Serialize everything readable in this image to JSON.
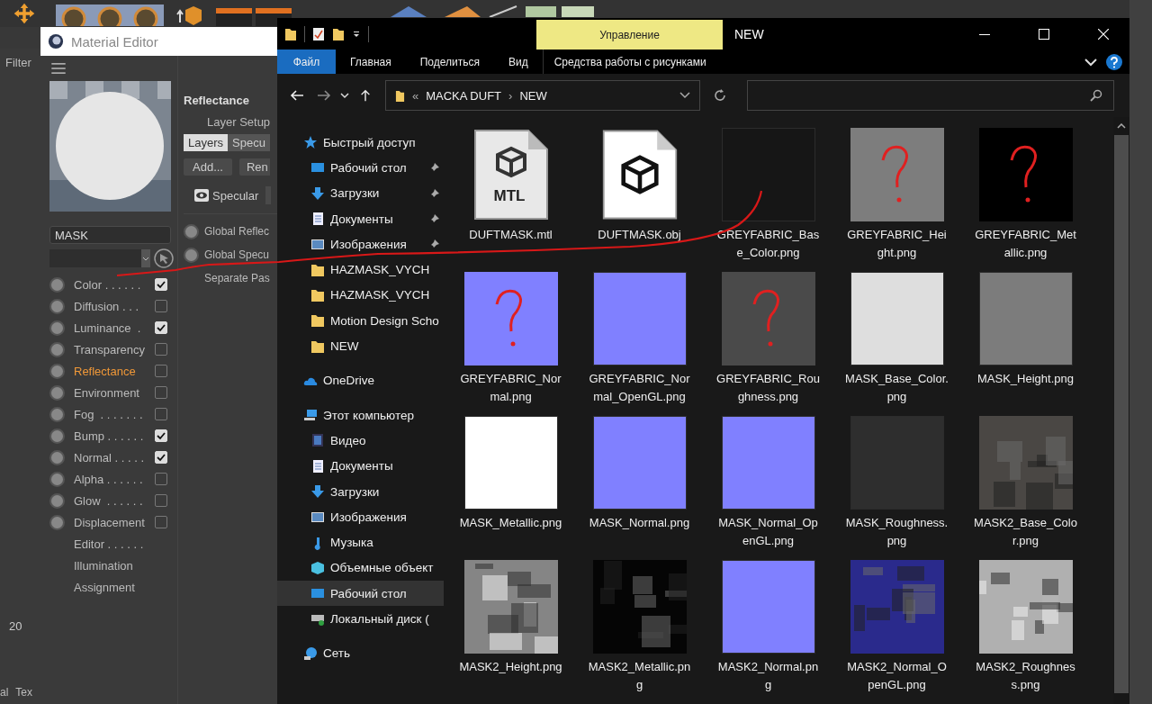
{
  "app_background": {
    "filter_label": "Filter",
    "frame_number": "20",
    "bottom_tabs": [
      "al",
      "Tex"
    ]
  },
  "material_editor": {
    "title": "Material Editor",
    "material_name": "MASK",
    "channels": [
      {
        "kind": "channel",
        "label": "Color . . . . . .",
        "checked": true,
        "selected": false
      },
      {
        "kind": "channel",
        "label": "Diffusion . . .",
        "checked": false,
        "selected": false
      },
      {
        "kind": "channel",
        "label": "Luminance  .",
        "checked": true,
        "selected": false
      },
      {
        "kind": "channel",
        "label": "Transparency",
        "checked": false,
        "selected": false
      },
      {
        "kind": "channel",
        "label": "Reflectance",
        "checked": false,
        "selected": true
      },
      {
        "kind": "channel",
        "label": "Environment",
        "checked": false,
        "selected": false
      },
      {
        "kind": "channel",
        "label": "Fog  . . . . . . .",
        "checked": false,
        "selected": false
      },
      {
        "kind": "channel",
        "label": "Bump . . . . . .",
        "checked": true,
        "selected": false
      },
      {
        "kind": "channel",
        "label": "Normal . . . . .",
        "checked": true,
        "selected": false
      },
      {
        "kind": "channel",
        "label": "Alpha . . . . . .",
        "checked": false,
        "selected": false
      },
      {
        "kind": "channel",
        "label": "Glow  . . . . . .",
        "checked": false,
        "selected": false
      },
      {
        "kind": "channel",
        "label": "Displacement",
        "checked": false,
        "selected": false
      },
      {
        "kind": "page",
        "label": "Editor . . . . . .",
        "selected": false
      },
      {
        "kind": "page",
        "label": "Illumination",
        "selected": false
      },
      {
        "kind": "page",
        "label": "Assignment",
        "selected": false
      }
    ],
    "section_title": "Reflectance",
    "layer_setup_label": "Layer Setup",
    "tabs": [
      {
        "label": "Layers",
        "selected": true
      },
      {
        "label": "Specu",
        "selected": false
      }
    ],
    "buttons": [
      "Add...",
      "Ren"
    ],
    "layer_name": "Specular",
    "options": [
      {
        "kind": "radio",
        "label": "Global Reflec"
      },
      {
        "kind": "radio",
        "label": "Global Specu"
      },
      {
        "kind": "text",
        "label": "Separate Pas"
      }
    ]
  },
  "explorer": {
    "context_tab": "Управление",
    "title": "NEW",
    "ribbon_tabs": [
      {
        "label": "Файл",
        "selected": true
      },
      {
        "label": "Главная",
        "selected": false
      },
      {
        "label": "Поделиться",
        "selected": false
      },
      {
        "label": "Вид",
        "selected": false
      },
      {
        "label": "Средства работы с рисунками",
        "selected": false
      }
    ],
    "path_prefix": "«",
    "path_separator": "›",
    "path": [
      "MACKA DUFT",
      "NEW"
    ],
    "nav": [
      {
        "kind": "star",
        "label": "Быстрый доступ",
        "selected": false,
        "children": [
          {
            "kind": "desktop",
            "label": "Рабочий стол",
            "pinned": true,
            "selected": false
          },
          {
            "kind": "download",
            "label": "Загрузки",
            "pinned": true,
            "selected": false
          },
          {
            "kind": "document",
            "label": "Документы",
            "pinned": true,
            "selected": false
          },
          {
            "kind": "images",
            "label": "Изображения",
            "pinned": true,
            "selected": false
          },
          {
            "kind": "folder",
            "label": "HAZMASK_VYCH",
            "pinned": false,
            "selected": false
          },
          {
            "kind": "folder",
            "label": "HAZMASK_VYCH",
            "pinned": false,
            "selected": false
          },
          {
            "kind": "folder",
            "label": "Motion Design Scho",
            "pinned": false,
            "selected": false
          },
          {
            "kind": "folder",
            "label": "NEW",
            "pinned": false,
            "selected": false
          }
        ]
      },
      {
        "kind": "cloud",
        "label": "OneDrive",
        "selected": false
      },
      {
        "kind": "pc",
        "label": "Этот компьютер",
        "selected": false,
        "children": [
          {
            "kind": "video",
            "label": "Видео",
            "pinned": false,
            "selected": false
          },
          {
            "kind": "document",
            "label": "Документы",
            "pinned": false,
            "selected": false
          },
          {
            "kind": "download",
            "label": "Загрузки",
            "pinned": false,
            "selected": false
          },
          {
            "kind": "images",
            "label": "Изображения",
            "pinned": false,
            "selected": false
          },
          {
            "kind": "music",
            "label": "Музыка",
            "pinned": false,
            "selected": false
          },
          {
            "kind": "cube",
            "label": "Объемные объект",
            "pinned": false,
            "selected": false
          },
          {
            "kind": "desktop",
            "label": "Рабочий стол",
            "pinned": false,
            "selected": true
          },
          {
            "kind": "disk",
            "label": "Локальный диск (",
            "pinned": false,
            "selected": false
          }
        ]
      },
      {
        "kind": "network",
        "label": "Сеть",
        "selected": false
      }
    ],
    "files": [
      {
        "kind": "mtl",
        "name": "DUFTMASK.mtl",
        "badge": "MTL"
      },
      {
        "kind": "obj",
        "name": "DUFTMASK.obj"
      },
      {
        "kind": "swatch",
        "name": "GREYFABRIC_Base_Color.png",
        "color": "#161616"
      },
      {
        "kind": "sketch",
        "name": "GREYFABRIC_Height.png",
        "color": "#7d7d7d"
      },
      {
        "kind": "sketch",
        "name": "GREYFABRIC_Metallic.png",
        "color": "#000000"
      },
      {
        "kind": "sketch",
        "name": "GREYFABRIC_Normal.png",
        "color": "#8080ff"
      },
      {
        "kind": "swatch",
        "name": "GREYFABRIC_Normal_OpenGL.png",
        "color": "#8080ff"
      },
      {
        "kind": "sketch",
        "name": "GREYFABRIC_Roughness.png",
        "color": "#4a4a4a"
      },
      {
        "kind": "swatch",
        "name": "MASK_Base_Color.png",
        "color": "#dedede"
      },
      {
        "kind": "swatch",
        "name": "MASK_Height.png",
        "color": "#7c7c7c"
      },
      {
        "kind": "swatch",
        "name": "MASK_Metallic.png",
        "color": "#ffffff"
      },
      {
        "kind": "swatch",
        "name": "MASK_Normal.png",
        "color": "#8080ff"
      },
      {
        "kind": "swatch",
        "name": "MASK_Normal_OpenGL.png",
        "color": "#8080ff"
      },
      {
        "kind": "swatch",
        "name": "MASK_Roughness.png",
        "color": "#2e2e2e"
      },
      {
        "kind": "picture",
        "name": "MASK2_Base_Color.png",
        "color": "#4a4744"
      },
      {
        "kind": "picture",
        "name": "MASK2_Height.png",
        "color": "#858585"
      },
      {
        "kind": "picture",
        "name": "MASK2_Metallic.png",
        "color": "#050505"
      },
      {
        "kind": "swatch",
        "name": "MASK2_Normal.png",
        "color": "#8080ff"
      },
      {
        "kind": "picture",
        "name": "MASK2_Normal_OpenGL.png",
        "color": "#2a2a8c"
      },
      {
        "kind": "picture",
        "name": "MASK2_Roughness.png",
        "color": "#b0b0b0"
      }
    ]
  }
}
